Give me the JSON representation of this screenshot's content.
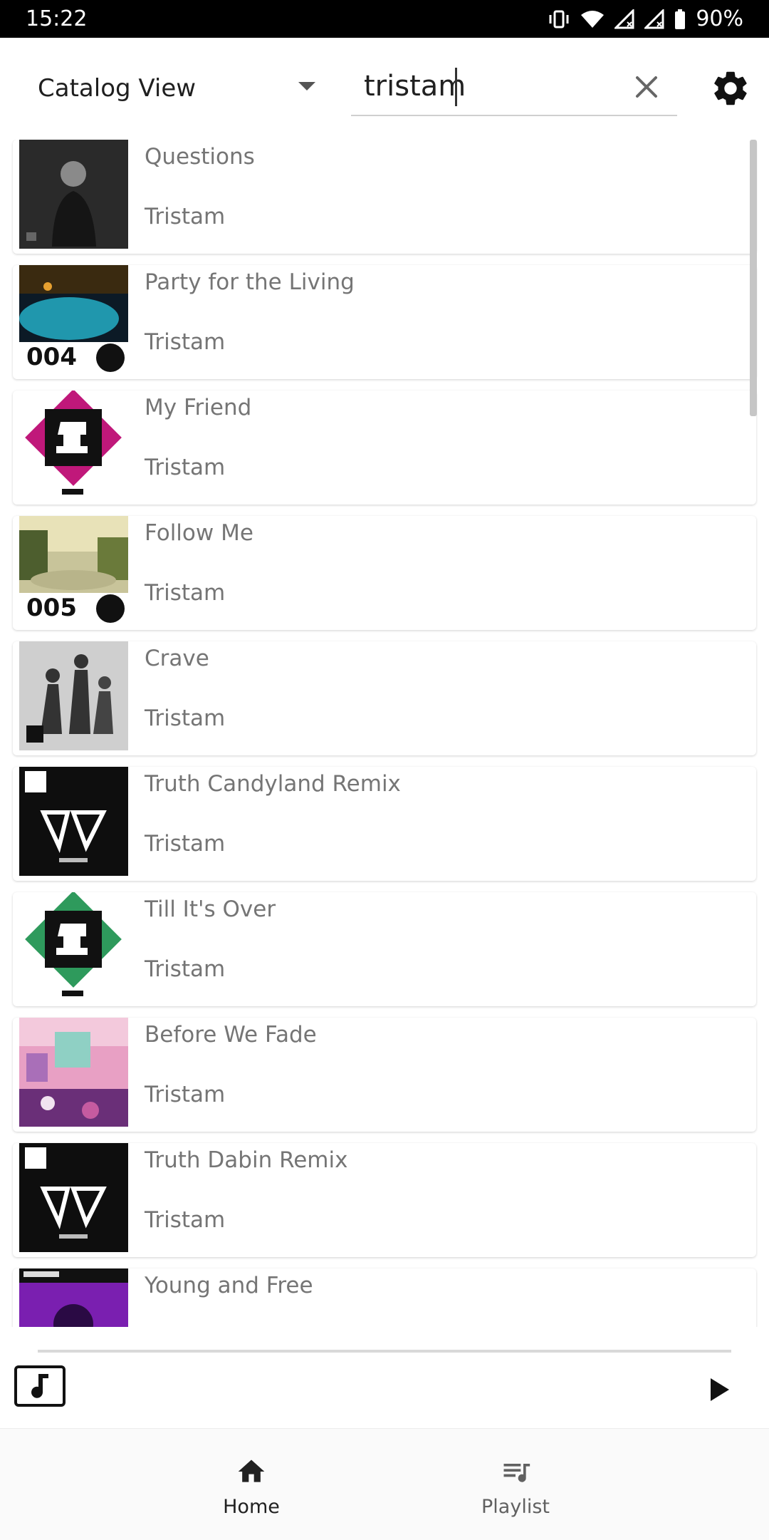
{
  "status": {
    "time": "15:22",
    "battery": "90%"
  },
  "toolbar": {
    "catalog_label": "Catalog View",
    "search_value": "tristam"
  },
  "tracks": [
    {
      "title": "Questions",
      "artist": "Tristam"
    },
    {
      "title": "Party for the Living",
      "artist": "Tristam"
    },
    {
      "title": "My Friend",
      "artist": "Tristam"
    },
    {
      "title": "Follow Me",
      "artist": "Tristam"
    },
    {
      "title": "Crave",
      "artist": "Tristam"
    },
    {
      "title": "Truth Candyland Remix",
      "artist": "Tristam"
    },
    {
      "title": "Till It's Over",
      "artist": "Tristam"
    },
    {
      "title": "Before We Fade",
      "artist": "Tristam"
    },
    {
      "title": "Truth Dabin Remix",
      "artist": "Tristam"
    },
    {
      "title": "Young and Free",
      "artist": ""
    }
  ],
  "nav": {
    "home_label": "Home",
    "playlist_label": "Playlist"
  }
}
